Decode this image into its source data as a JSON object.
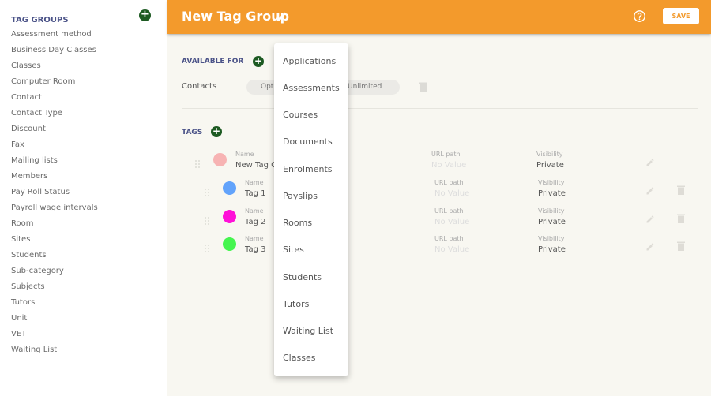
{
  "sidebar": {
    "title": "TAG GROUPS",
    "add_icon": "plus-circle-icon",
    "items": [
      "Assessment method",
      "Business Day Classes",
      "Classes",
      "Computer Room",
      "Contact",
      "Contact Type",
      "Discount",
      "Fax",
      "Mailing lists",
      "Members",
      "Pay Roll Status",
      "Payroll wage intervals",
      "Room",
      "Sites",
      "Students",
      "Sub-category",
      "Subjects",
      "Tutors",
      "Unit",
      "VET",
      "Waiting List"
    ]
  },
  "header": {
    "title": "New Tag Group",
    "edit_icon": "pencil-icon",
    "help_icon": "help-circle-icon",
    "save_label": "SAVE",
    "color": "#f39a2c"
  },
  "available_for": {
    "label": "AVAILABLE FOR",
    "rows": [
      {
        "entity": "Contacts",
        "option_left": "Opt",
        "option_right": "Unlimited"
      }
    ]
  },
  "tags": {
    "label": "TAGS",
    "field_labels": {
      "name": "Name",
      "url": "URL path",
      "visibility": "Visibility"
    },
    "rows": [
      {
        "name": "New Tag G",
        "color": "#f7b3b3",
        "url": "No Value",
        "visibility": "Private",
        "deletable": false
      },
      {
        "name": "Tag 1",
        "color": "#62a3fb",
        "url": "No Value",
        "visibility": "Private",
        "deletable": true
      },
      {
        "name": "Tag 2",
        "color": "#ff11d8",
        "url": "No Value",
        "visibility": "Private",
        "deletable": true
      },
      {
        "name": "Tag 3",
        "color": "#45f54f",
        "url": "No Value",
        "visibility": "Private",
        "deletable": true
      }
    ]
  },
  "dropdown": {
    "items": [
      "Applications",
      "Assessments",
      "Courses",
      "Documents",
      "Enrolments",
      "Payslips",
      "Rooms",
      "Sites",
      "Students",
      "Tutors",
      "Waiting List",
      "Classes"
    ]
  },
  "colors": {
    "accent_green": "#1d5a22",
    "section_label": "#4b5388"
  }
}
